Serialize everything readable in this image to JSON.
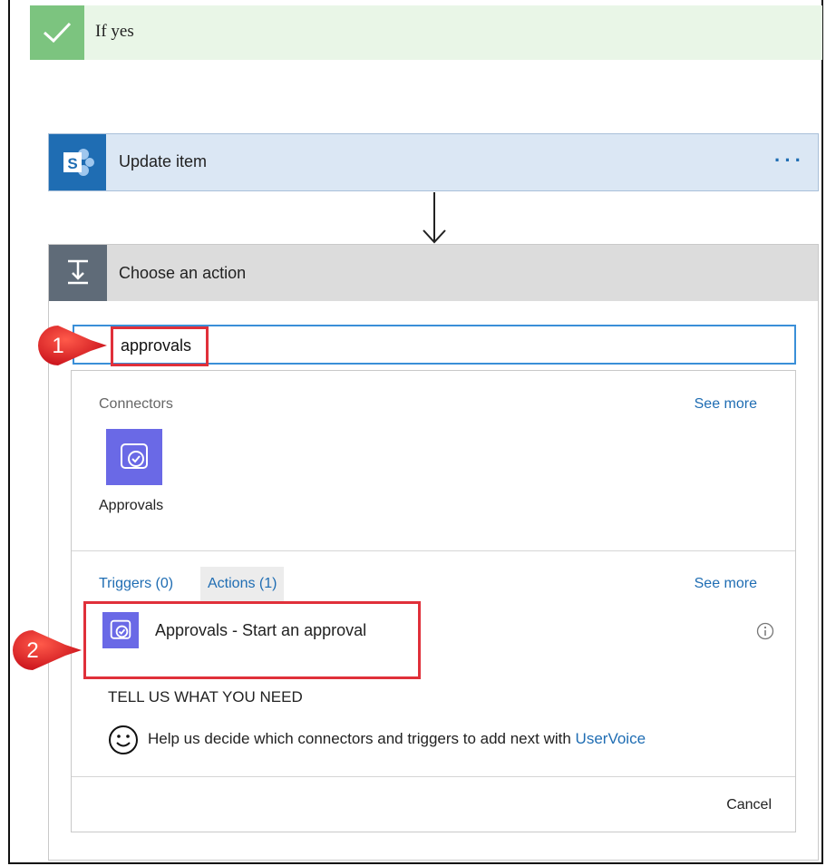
{
  "if_yes": {
    "label": "If yes"
  },
  "update_card": {
    "title": "Update item",
    "more": "···"
  },
  "choose_card": {
    "title": "Choose an action"
  },
  "search": {
    "value": "approvals"
  },
  "connectors": {
    "label": "Connectors",
    "see_more": "See more",
    "items": [
      {
        "name": "Approvals",
        "icon": "approvals-icon"
      }
    ]
  },
  "tabs": {
    "triggers": "Triggers (0)",
    "actions": "Actions (1)",
    "see_more": "See more"
  },
  "action_result": {
    "label": "Approvals - Start an approval",
    "icon": "approvals-icon"
  },
  "feedback": {
    "heading": "TELL US WHAT YOU NEED",
    "text": "Help us decide which connectors and triggers to add next with ",
    "link": "UserVoice"
  },
  "footer": {
    "cancel": "Cancel"
  },
  "callouts": {
    "step1": "1",
    "step2": "2"
  },
  "colors": {
    "success_green": "#7cc47f",
    "sharepoint_blue": "#1f6db3",
    "approvals_purple": "#6a69e6",
    "highlight_red": "#e0303a",
    "link_blue": "#1f6db3"
  }
}
